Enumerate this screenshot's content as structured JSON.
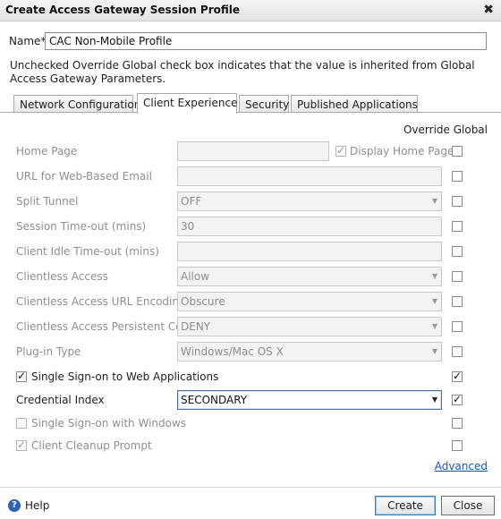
{
  "window": {
    "title": "Create Access Gateway Session Profile",
    "close_glyph": "✖"
  },
  "name_field": {
    "label": "Name*",
    "value": "CAC Non-Mobile Profile"
  },
  "info_text": "Unchecked Override Global check box indicates that the value is inherited from Global Access Gateway Parameters.",
  "tabs": [
    {
      "label": "Network Configuration",
      "active": false
    },
    {
      "label": "Client Experience",
      "active": true
    },
    {
      "label": "Security",
      "active": false
    },
    {
      "label": "Published Applications",
      "active": false
    }
  ],
  "override_header": "Override Global",
  "rows": [
    {
      "label": "Home Page",
      "value": "",
      "override": false,
      "extra_label": "Display Home Page",
      "extra_checked": true
    },
    {
      "label": "URL for Web-Based Email",
      "value": "",
      "override": false
    },
    {
      "label": "Split Tunnel",
      "value": "OFF",
      "override": false
    },
    {
      "label": "Session Time-out (mins)",
      "value": "30",
      "override": false
    },
    {
      "label": "Client Idle Time-out (mins)",
      "value": "",
      "override": false
    },
    {
      "label": "Clientless Access",
      "value": "Allow",
      "override": false
    },
    {
      "label": "Clientless Access URL Encoding",
      "value": "Obscure",
      "override": false
    },
    {
      "label": "Clientless Access Persistent Co...",
      "value": "DENY",
      "override": false
    },
    {
      "label": "Plug-in Type",
      "value": "Windows/Mac OS X",
      "override": false
    },
    {
      "label": "Single Sign-on to Web Applications",
      "checked": true,
      "override": true
    },
    {
      "label": "Credential Index",
      "value": "SECONDARY",
      "override": true
    },
    {
      "label": "Single Sign-on with Windows",
      "checked": false,
      "override": false
    },
    {
      "label": "Client Cleanup Prompt",
      "checked": true,
      "override": false
    }
  ],
  "advanced_link": "Advanced",
  "footer": {
    "help_label": "Help",
    "help_icon": "?",
    "create_label": "Create",
    "close_label": "Close"
  },
  "glyphs": {
    "dropdown_arrow": "▼"
  },
  "colors": {
    "link": "#1a54c4",
    "disabled_text": "#8e8e8e",
    "help_icon": "#2c62b8"
  }
}
